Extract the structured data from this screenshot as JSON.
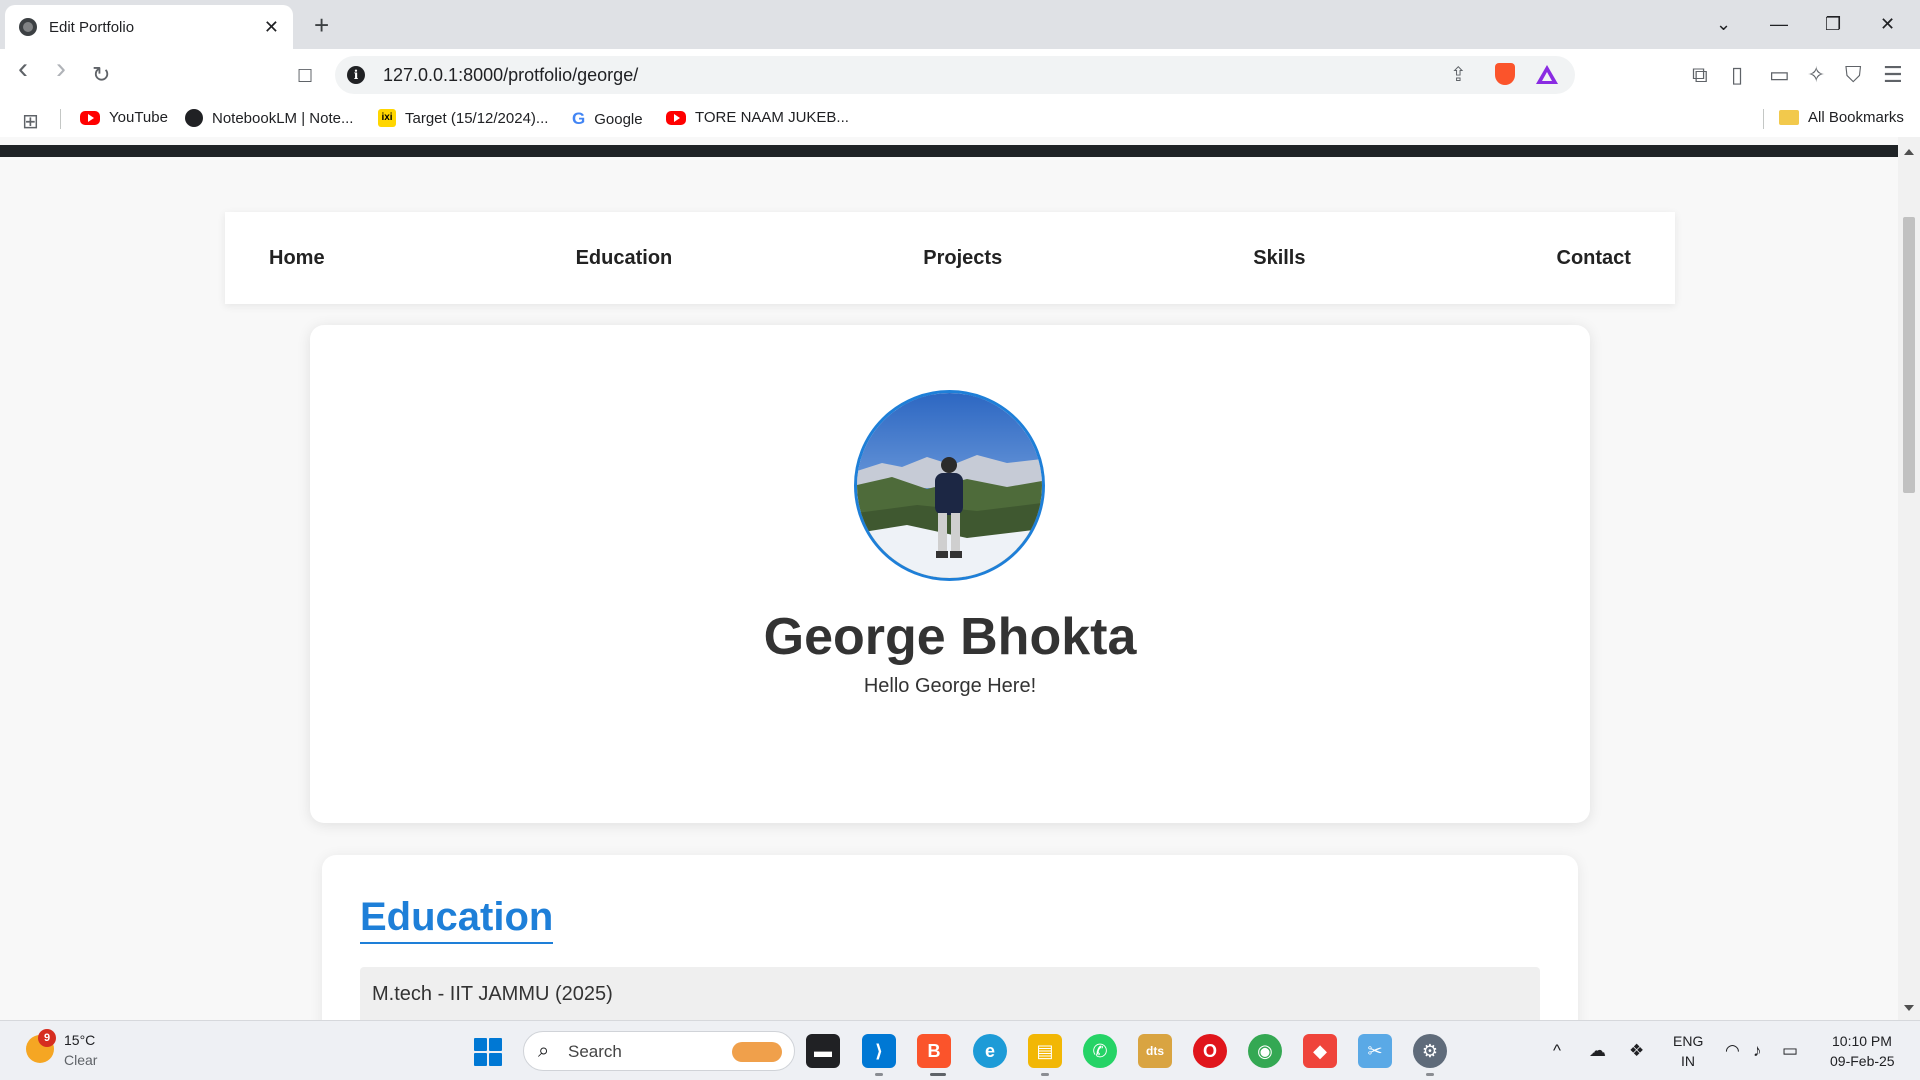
{
  "browser": {
    "tab_title": "Edit Portfolio",
    "tab_close": "✕",
    "new_tab": "+",
    "url": "127.0.0.1:8000/protfolio/george/",
    "window_controls": [
      "⌄",
      "—",
      "❐",
      "✕"
    ]
  },
  "toolbar": {
    "back": "‹",
    "forward": "›",
    "reload": "↻",
    "bookmark": "☐",
    "share": "⇪",
    "right_icons": [
      "⧉",
      "▯",
      "▭",
      "✧",
      "⛉",
      "☰"
    ]
  },
  "bookmarks": {
    "apps_icon": "⊞",
    "items": [
      {
        "label": "YouTube",
        "icon": "youtube-icon"
      },
      {
        "label": "NotebookLM | Note...",
        "icon": "notebooklm-icon"
      },
      {
        "label": "Target (15/12/2024)...",
        "icon": "ixigo-icon"
      },
      {
        "label": "Google",
        "icon": "google-icon"
      },
      {
        "label": "TORE NAAM JUKEB...",
        "icon": "youtube-icon"
      }
    ],
    "all_bookmarks": "All Bookmarks",
    "ixi_glyph": "ixi",
    "g_glyph": "G"
  },
  "page": {
    "nav": [
      "Home",
      "Education",
      "Projects",
      "Skills",
      "Contact"
    ],
    "profile": {
      "name": "George Bhokta",
      "tagline": "Hello George Here!"
    },
    "education": {
      "heading": "Education",
      "items": [
        "M.tech - IIT JAMMU (2025)"
      ]
    },
    "accent_color": "#1e7fd8"
  },
  "taskbar": {
    "weather_badge": "9",
    "weather_temp": "15°C",
    "weather_desc": "Clear",
    "search_icon": "⌕",
    "search_label": "Search",
    "sys_caret": "^",
    "lang_top": "ENG",
    "lang_bottom": "IN",
    "time": "10:10 PM",
    "date": "09-Feb-25",
    "apps": [
      {
        "name": "file-explorer",
        "glyph": "▬"
      },
      {
        "name": "vscode",
        "glyph": "⟩"
      },
      {
        "name": "brave",
        "glyph": "B"
      },
      {
        "name": "edge",
        "glyph": "e"
      },
      {
        "name": "files",
        "glyph": "▤"
      },
      {
        "name": "whatsapp",
        "glyph": "✆"
      },
      {
        "name": "dts",
        "glyph": "dts"
      },
      {
        "name": "opera",
        "glyph": "O"
      },
      {
        "name": "chrome",
        "glyph": "◉"
      },
      {
        "name": "anydesk",
        "glyph": "◆"
      },
      {
        "name": "snipping-tool",
        "glyph": "✂"
      },
      {
        "name": "settings",
        "glyph": "⚙"
      }
    ]
  }
}
